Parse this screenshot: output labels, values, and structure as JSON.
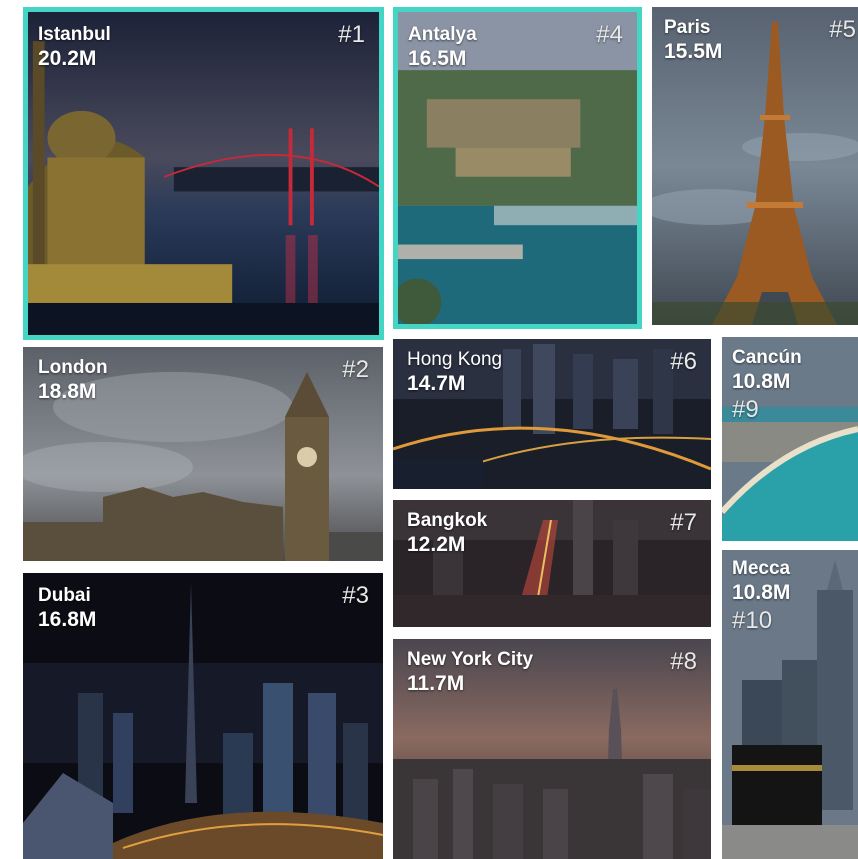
{
  "cities": [
    {
      "rank": "#1",
      "name": "Istanbul",
      "visitors": "20.2M"
    },
    {
      "rank": "#2",
      "name": "London",
      "visitors": "18.8M"
    },
    {
      "rank": "#3",
      "name": "Dubai",
      "visitors": "16.8M"
    },
    {
      "rank": "#4",
      "name": "Antalya",
      "visitors": "16.5M"
    },
    {
      "rank": "#5",
      "name": "Paris",
      "visitors": "15.5M"
    },
    {
      "rank": "#6",
      "name": "Hong Kong",
      "visitors": "14.7M"
    },
    {
      "rank": "#7",
      "name": "Bangkok",
      "visitors": "12.2M"
    },
    {
      "rank": "#8",
      "name": "New York City",
      "visitors": "11.7M"
    },
    {
      "rank": "#9",
      "name": "Cancún",
      "visitors": "10.8M"
    },
    {
      "rank": "#10",
      "name": "Mecca",
      "visitors": "10.8M"
    }
  ],
  "colors": {
    "highlight": "#45d5c4"
  }
}
